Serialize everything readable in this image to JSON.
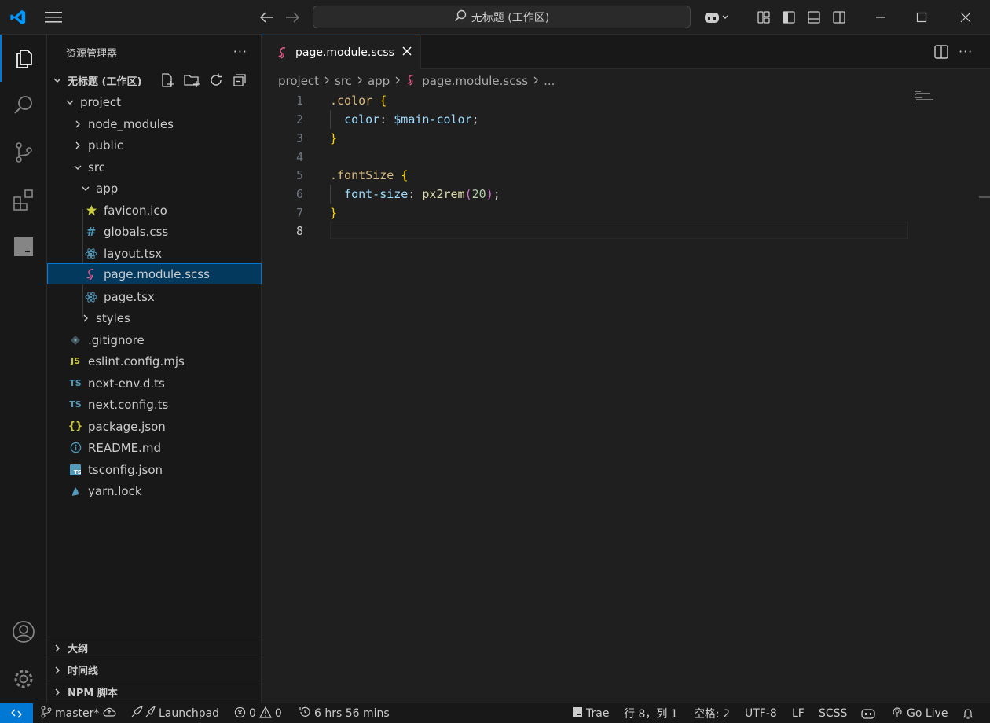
{
  "titlebar": {
    "search_text": "无标题 (工作区)"
  },
  "sidebar": {
    "title": "资源管理器",
    "more": "···",
    "workspace": "无标题 (工作区)",
    "tree": [
      {
        "label": "project",
        "depth": 0,
        "kind": "folder-open"
      },
      {
        "label": "node_modules",
        "depth": 1,
        "kind": "folder"
      },
      {
        "label": "public",
        "depth": 1,
        "kind": "folder"
      },
      {
        "label": "src",
        "depth": 1,
        "kind": "folder-open"
      },
      {
        "label": "app",
        "depth": 2,
        "kind": "folder-open"
      },
      {
        "label": "favicon.ico",
        "depth": 3,
        "kind": "ico"
      },
      {
        "label": "globals.css",
        "depth": 3,
        "kind": "css"
      },
      {
        "label": "layout.tsx",
        "depth": 3,
        "kind": "react"
      },
      {
        "label": "page.module.scss",
        "depth": 3,
        "kind": "scss"
      },
      {
        "label": "page.tsx",
        "depth": 3,
        "kind": "react"
      },
      {
        "label": "styles",
        "depth": 2,
        "kind": "folder"
      },
      {
        "label": ".gitignore",
        "depth": 1,
        "kind": "git"
      },
      {
        "label": "eslint.config.mjs",
        "depth": 1,
        "kind": "js"
      },
      {
        "label": "next-env.d.ts",
        "depth": 1,
        "kind": "ts"
      },
      {
        "label": "next.config.ts",
        "depth": 1,
        "kind": "ts"
      },
      {
        "label": "package.json",
        "depth": 1,
        "kind": "json"
      },
      {
        "label": "README.md",
        "depth": 1,
        "kind": "info"
      },
      {
        "label": "tsconfig.json",
        "depth": 1,
        "kind": "tsconfig"
      },
      {
        "label": "yarn.lock",
        "depth": 1,
        "kind": "yarn"
      }
    ],
    "selected_index": 8,
    "panels": [
      "大纲",
      "时间线",
      "NPM 脚本"
    ]
  },
  "editor": {
    "tab_label": "page.module.scss",
    "breadcrumb": [
      "project",
      "src",
      "app",
      "page.module.scss",
      "..."
    ],
    "line_numbers": [
      "1",
      "2",
      "3",
      "4",
      "5",
      "6",
      "7",
      "8"
    ],
    "active_line": 8,
    "code": {
      "l1_sel": ".color",
      "l1_brace": "{",
      "l2_prop": "color",
      "l2_colon": ": ",
      "l2_var": "$main-color",
      "l2_semi": ";",
      "l3_brace": "}",
      "l5_sel": ".fontSize",
      "l5_brace": "{",
      "l6_prop": "font-size",
      "l6_colon": ": ",
      "l6_fn": "px2rem",
      "l6_open": "(",
      "l6_num": "20",
      "l6_close": ")",
      "l6_semi": ";",
      "l7_brace": "}"
    }
  },
  "statusbar": {
    "branch": "master*",
    "launchpad": "Launchpad",
    "errors": "0",
    "warnings": "0",
    "time": "6 hrs 56 mins",
    "trae": "Trae",
    "position": "行 8，列 1",
    "spaces": "空格: 2",
    "encoding": "UTF-8",
    "eol": "LF",
    "language": "SCSS",
    "golive": "Go Live"
  },
  "colors": {
    "accent": "#0078d4",
    "selected_bg": "#04395e",
    "scss": "#e05a8a"
  }
}
